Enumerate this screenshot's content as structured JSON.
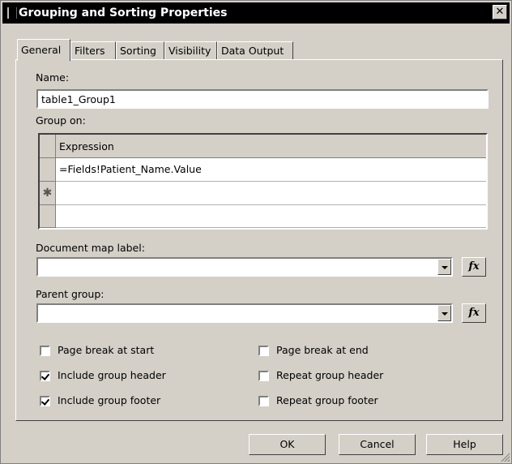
{
  "window": {
    "title": "Grouping and Sorting Properties"
  },
  "tabs": [
    "General",
    "Filters",
    "Sorting",
    "Visibility",
    "Data Output"
  ],
  "general": {
    "name_label": "Name:",
    "name_value": "table1_Group1",
    "group_on_label": "Group on:",
    "grid": {
      "column_header": "Expression",
      "rows": [
        "=Fields!Patient_Name.Value",
        "",
        ""
      ],
      "new_row_marker": "✱"
    },
    "doc_map_label": "Document map label:",
    "doc_map_value": "",
    "parent_group_label": "Parent group:",
    "parent_group_value": "",
    "fx_label": "fx",
    "checkboxes": {
      "page_break_start": {
        "label": "Page break at start",
        "checked": false
      },
      "include_header": {
        "label": "Include group header",
        "checked": true
      },
      "include_footer": {
        "label": "Include group footer",
        "checked": true
      },
      "page_break_end": {
        "label": "Page break at end",
        "checked": false
      },
      "repeat_header": {
        "label": "Repeat group header",
        "checked": false
      },
      "repeat_footer": {
        "label": "Repeat group footer",
        "checked": false
      }
    }
  },
  "buttons": {
    "ok": "OK",
    "cancel": "Cancel",
    "help": "Help"
  }
}
